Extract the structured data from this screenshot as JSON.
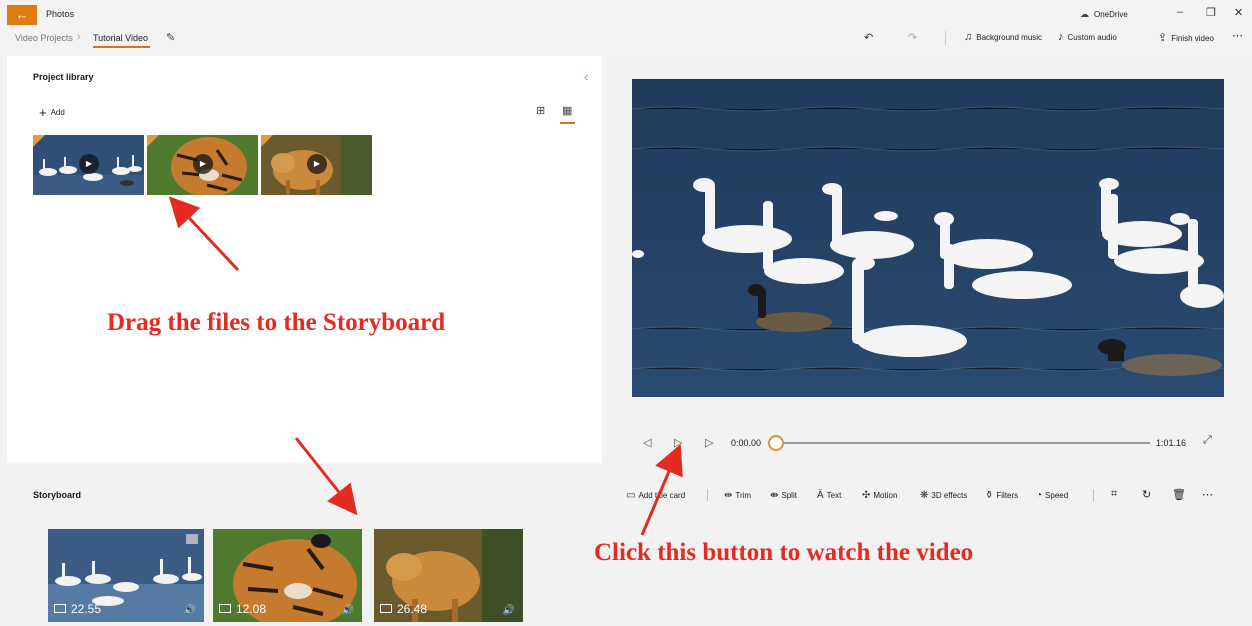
{
  "titlebar": {
    "app_title": "Photos",
    "back_icon": "back-arrow-icon",
    "breadcrumb": [
      "Video Projects",
      "Tutorial Video"
    ],
    "onedrive_label": "OneDrive",
    "toolbar": {
      "background_music": "Background music",
      "custom_audio": "Custom audio",
      "finish_video": "Finish video"
    },
    "accent_color": "#e07b12"
  },
  "library": {
    "title": "Project library",
    "add_label": "Add",
    "clips": [
      {
        "subject": "swans"
      },
      {
        "subject": "tiger"
      },
      {
        "subject": "wolf"
      }
    ]
  },
  "player": {
    "time_current": "0:00.00",
    "time_total": "1:01.16"
  },
  "storyboard": {
    "title": "Storyboard",
    "tools": {
      "add_title_card": "Add title card",
      "trim": "Trim",
      "split": "Split",
      "text": "Text",
      "motion": "Motion",
      "effects_3d": "3D effects",
      "filters": "Filters",
      "speed": "Speed"
    },
    "clips": [
      {
        "duration": "22.55"
      },
      {
        "duration": "12.08"
      },
      {
        "duration": "26.48"
      }
    ]
  },
  "annotations": {
    "drag_hint": "Drag the files to the Storyboard",
    "play_hint": "Click this button to watch the video",
    "color": "#e32b22"
  }
}
